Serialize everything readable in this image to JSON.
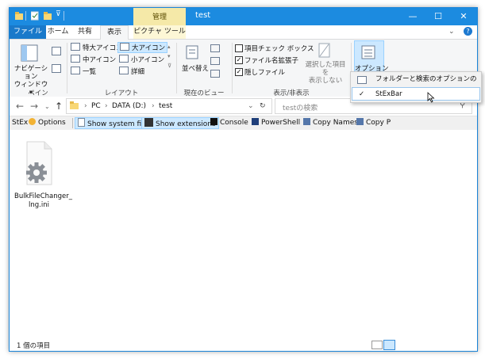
{
  "window": {
    "title": "test",
    "context_tab_label": "管理",
    "controls": [
      "—",
      "☐",
      "✕"
    ]
  },
  "ribbon_tabs": [
    {
      "label": "ファイル"
    },
    {
      "label": "ホーム"
    },
    {
      "label": "共有"
    },
    {
      "label": "表示"
    },
    {
      "label": "ピクチャ ツール"
    }
  ],
  "ribbon": {
    "panes": {
      "nav_pane_label": "ナビゲーション\nウィンドウ▾",
      "group_label": "ペイン"
    },
    "layout": {
      "items": [
        "特大アイコン",
        "大アイコン",
        "中アイコン",
        "小アイコン",
        "一覧",
        "詳細"
      ],
      "selected": "大アイコン",
      "group_label": "レイアウト"
    },
    "current_view": {
      "sort_label": "並べ替え",
      "group_label": "現在のビュー"
    },
    "show_hide": {
      "checks": [
        {
          "label": "項目チェック ボックス",
          "checked": false
        },
        {
          "label": "ファイル名拡張子",
          "checked": true
        },
        {
          "label": "隠しファイル",
          "checked": true
        }
      ],
      "hide_selected_label": "選択した項目を\n表示しない",
      "group_label": "表示/非表示"
    },
    "options_label": "オプション"
  },
  "address": {
    "crumbs": [
      "PC",
      "DATA (D:)",
      "test"
    ],
    "search_placeholder": "testの検索"
  },
  "stexbar": {
    "items": [
      {
        "label": "StEx"
      },
      {
        "label": "Options"
      },
      {
        "label": "Show system files",
        "active": true
      },
      {
        "label": "Show extensions",
        "active": true
      },
      {
        "label": "Console"
      },
      {
        "label": "PowerShell"
      },
      {
        "label": "Copy Names"
      },
      {
        "label": "Copy P"
      }
    ]
  },
  "files": [
    {
      "name": "BulkFileChanger_lng.ini",
      "name_line1": "BulkFileChanger_",
      "name_line2": "lng.ini"
    }
  ],
  "status": {
    "item_count": "1 個の項目"
  },
  "options_menu": {
    "items": [
      {
        "label": "フォルダーと検索のオプションの変更(O)",
        "checked": false
      },
      {
        "label": "StExBar",
        "checked": true
      }
    ]
  },
  "colors": {
    "accent": "#1c8be0",
    "file_tab": "#1979ca",
    "context_tab": "#f5e9a8",
    "selection": "#cce8ff"
  }
}
